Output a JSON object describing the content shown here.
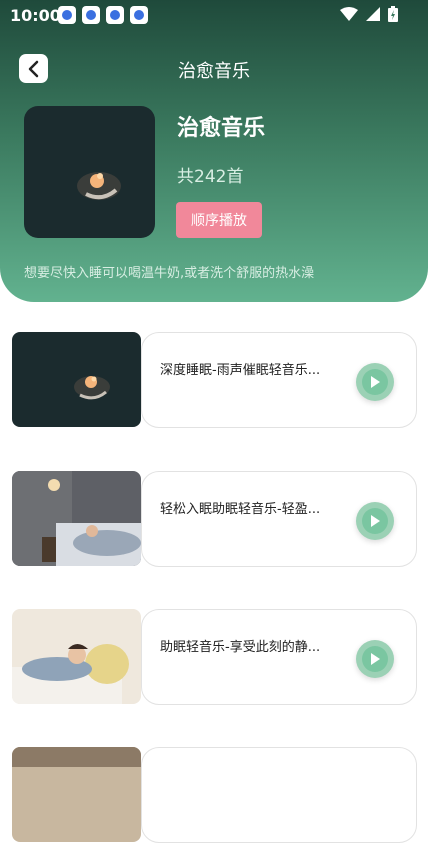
{
  "status_bar": {
    "time": "10:00",
    "app_icons": [
      "baidu-icon",
      "baidu-icon",
      "baidu-icon",
      "baidu-icon"
    ]
  },
  "header": {
    "title": "治愈音乐"
  },
  "album": {
    "title": "治愈音乐",
    "count": "共242首",
    "play_button": "顺序播放",
    "description": "想要尽快入睡可以喝温牛奶,或者洗个舒服的热水澡"
  },
  "tracks": [
    {
      "title": "深度睡眠-雨声催眠轻音乐...",
      "thumb": "dark-sleep-scene"
    },
    {
      "title": "轻松入眠助眠轻音乐-轻盈...",
      "thumb": "bedroom-sleep-scene"
    },
    {
      "title": "助眠轻音乐-享受此刻的静...",
      "thumb": "pillow-sleep-scene"
    }
  ],
  "colors": {
    "header_gradient_top": "#1f4a3b",
    "header_gradient_bottom": "#62b28f",
    "accent_pink": "#f1889a",
    "play_green": "#7ac6a1"
  }
}
